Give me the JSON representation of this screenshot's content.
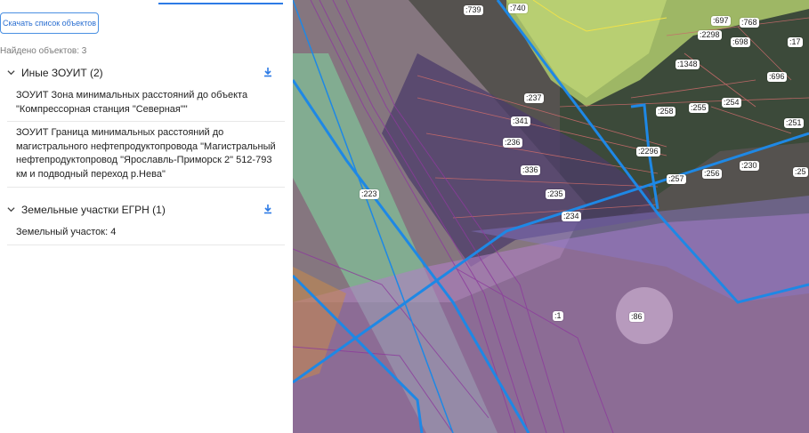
{
  "panel": {
    "download_button": "Скачать список объектов",
    "found_count": "Найдено объектов: 3",
    "groups": [
      {
        "title": "Иные ЗОУИТ (2)",
        "items": [
          "ЗОУИТ Зона минимальных расстояний до объекта \"Компрессорная станция \"Северная\"\"",
          "ЗОУИТ Граница минимальных расстояний до магистрального нефтепродуктопровода \"Магистральный нефтепродуктопровод \"Ярославль-Приморск 2\" 512-793 км и подводный переход р.Нева\""
        ]
      },
      {
        "title": "Земельные участки ЕГРН (1)",
        "items": [
          "Земельный участок: 4"
        ]
      }
    ]
  },
  "map": {
    "parcel_labels": [
      ":739",
      ":740",
      ":697",
      ":768",
      ":2298",
      ":698",
      ":17",
      ":1348",
      ":696",
      ":237",
      ":258",
      ":255",
      ":254",
      ":341",
      ":251",
      ":236",
      ":2296",
      ":230",
      ":336",
      ":257",
      ":256",
      ":25",
      ":235",
      ":223",
      ":234",
      ":1",
      ":86"
    ],
    "colors": {
      "boundary_blue": "#1e88e5",
      "zone_purple": "#9b59b6",
      "zone_green": "#7fd9a0",
      "forest_green": "#b5d36b",
      "parcel_red": "#d9534f"
    }
  }
}
